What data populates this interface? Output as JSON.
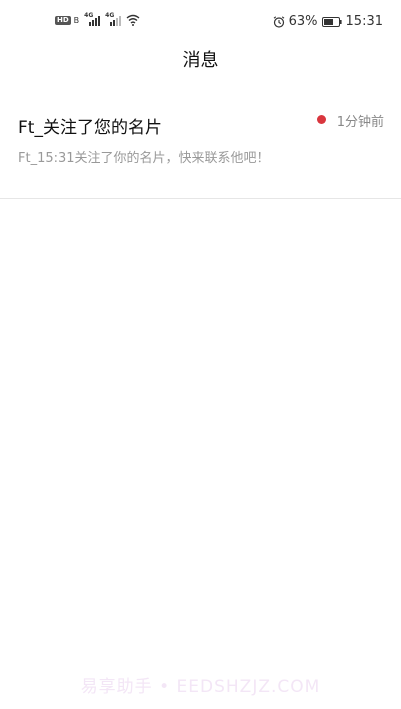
{
  "status_bar": {
    "hd_label": "HD",
    "hd_sub": "B",
    "signal1_net": "4G",
    "signal2_net": "4G",
    "battery_percent": "63%",
    "time": "15:31"
  },
  "header": {
    "title": "消息"
  },
  "messages": [
    {
      "title": "Ft_关注了您的名片",
      "time": "1分钟前",
      "preview": "Ft_15:31关注了你的名片，快来联系他吧！",
      "unread": true
    }
  ],
  "watermark": "易享助手 • EEDSHZJZ.COM",
  "colors": {
    "unread_dot": "#d9363e",
    "divider": "#e6e6e6"
  }
}
